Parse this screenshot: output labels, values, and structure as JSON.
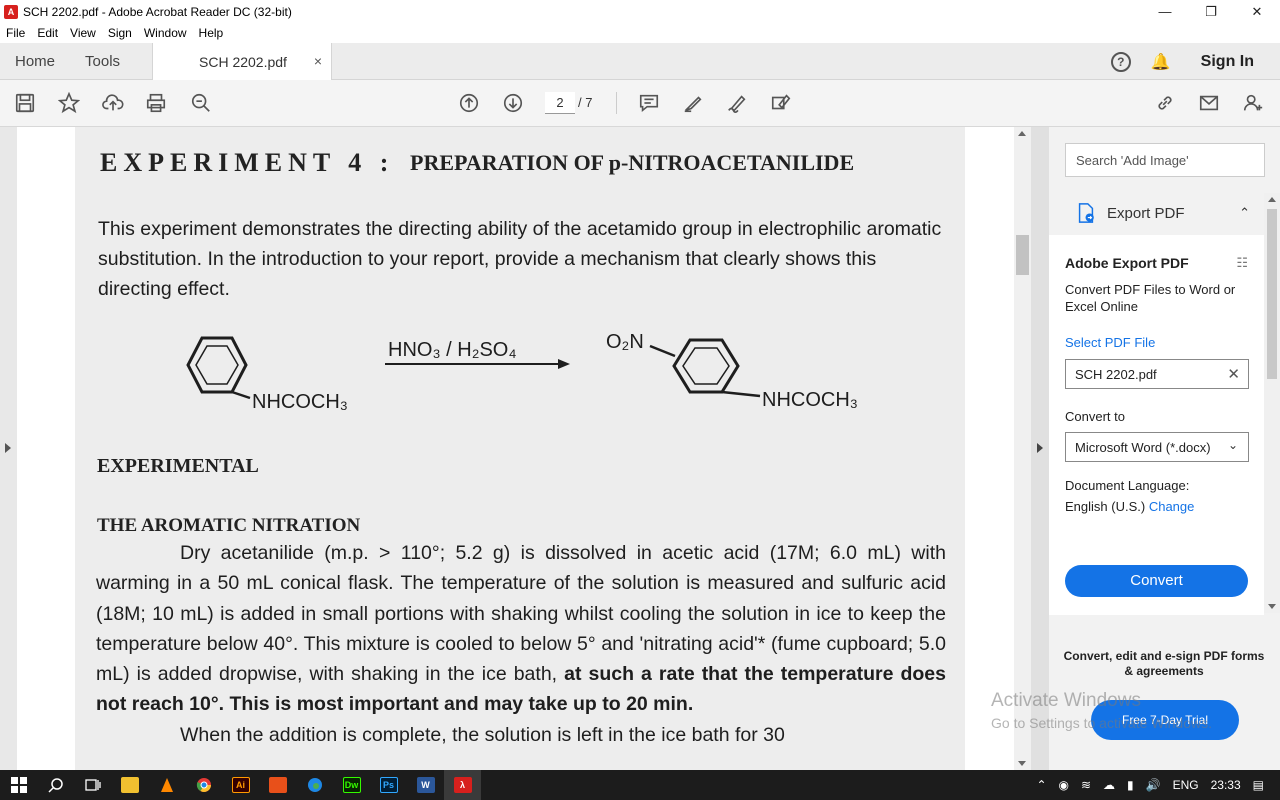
{
  "window": {
    "title": "SCH 2202.pdf - Adobe Acrobat Reader DC (32-bit)",
    "app_icon": "acrobat-icon",
    "buttons": [
      "minimize",
      "restore",
      "close"
    ]
  },
  "menu": [
    "File",
    "Edit",
    "View",
    "Sign",
    "Window",
    "Help"
  ],
  "tabs": {
    "home": "Home",
    "tools": "Tools",
    "document": "SCH 2202.pdf",
    "close_glyph": "×",
    "help_glyph": "?",
    "sign_in": "Sign In"
  },
  "toolbar": {
    "icons": [
      "save-icon",
      "star-icon",
      "upload-icon",
      "print-icon",
      "zoom-icon",
      "page-up-icon",
      "page-down-icon",
      "comment-icon",
      "highlight-icon",
      "sign-icon",
      "fill-sign-icon",
      "link-icon",
      "mail-icon",
      "add-user-icon"
    ],
    "page_current": "2",
    "page_total": "/ 7"
  },
  "document": {
    "experiment_label": "EXPERIMENT 4 :",
    "experiment_title": "PREPARATION OF p-NITROACETANILIDE",
    "intro": "This experiment demonstrates the directing ability of the acetamido group in electrophilic aromatic substitution. In the introduction to your report, provide a mechanism that clearly shows this directing effect.",
    "reagents": "HNO₃ / H₂SO₄",
    "reactant_group": "NHCOCH₃",
    "product_nitro": "O₂N",
    "product_group": "NHCOCH₃",
    "section_experimental": "EXPERIMENTAL",
    "section_nitration": "THE AROMATIC NITRATION",
    "body_para1": "Dry acetanilide (m.p. > 110°; 5.2 g) is dissolved in acetic acid (17M; 6.0 mL) with warming in a 50 mL conical flask. The temperature of the solution is measured and sulfuric acid (18M; 10 mL) is added in small portions with shaking whilst cooling the solution in ice to keep the temperature below 40°. This mixture is cooled to below 5° and 'nitrating acid'* (fume cupboard; 5.0 mL) is added dropwise, with shaking in the ice bath,",
    "body_bold": "at such a rate that the temperature does not reach 10°. This is most important and may take up to 20 min.",
    "body_para2": "When the addition is complete, the solution is left in the ice bath for 30"
  },
  "right_panel": {
    "search_placeholder": "Search 'Add Image'",
    "export_header": "Export PDF",
    "adobe_export_title": "Adobe Export PDF",
    "description": "Convert PDF Files to Word or Excel Online",
    "select_file_label": "Select PDF File",
    "selected_file": "SCH 2202.pdf",
    "clear_glyph": "✕",
    "convert_to_label": "Convert to",
    "convert_to_value": "Microsoft Word (*.docx)",
    "doc_language_label": "Document Language:",
    "doc_language_value": "English (U.S.)",
    "change_link": "Change",
    "convert_button": "Convert",
    "promo": "Convert, edit and e-sign PDF forms & agreements",
    "trial_button": "Free 7-Day Trial"
  },
  "watermark": {
    "line1": "Activate Windows",
    "line2": "Go to Settings to activate Windows."
  },
  "taskbar": {
    "apps": [
      "windows-icon",
      "search-icon",
      "task-view-icon",
      "file-explorer-icon",
      "vlc-icon",
      "chrome-icon",
      "illustrator-icon",
      "app-icon",
      "edge-icon",
      "dreamweaver-icon",
      "photoshop-icon",
      "word-icon",
      "acrobat-icon"
    ],
    "app_labels": {
      "ai": "Ai",
      "dw": "Dw",
      "ps": "Ps",
      "w": "W"
    },
    "tray_lang": "ENG",
    "clock": "23:33"
  }
}
